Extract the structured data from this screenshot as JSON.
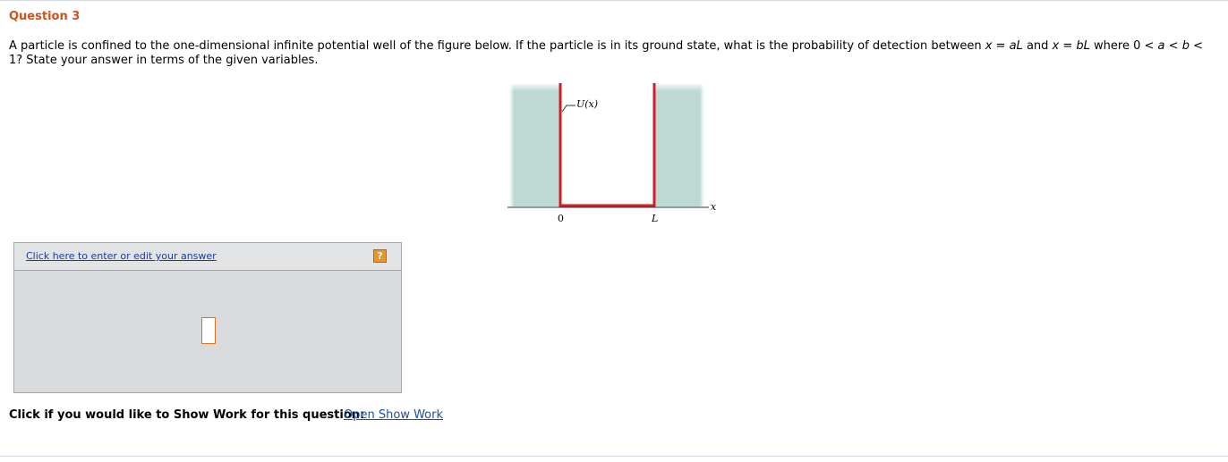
{
  "question": {
    "title": "Question 3",
    "text_before_x1": "A particle is confined to the one-dimensional infinite potential well of the figure below. If the particle is in its ground state, what is the probability of detection between ",
    "x1_var": "x",
    "x1_eq": " = ",
    "x1_val": "aL",
    "and": " and ",
    "x2_var": "x",
    "x2_eq": " = ",
    "x2_val": "bL",
    "where": " where 0 < ",
    "a": "a",
    "lt": " < ",
    "b": "b",
    "tail": " < 1? State your answer in terms of the given variables."
  },
  "figure": {
    "curve_label": "U(x)",
    "axis_label": "x",
    "tick_zero": "0",
    "tick_L": "L",
    "wall_color": "#d21f26",
    "region_color": "#bcd9d4"
  },
  "answer": {
    "link_text": "Click here to enter or edit your answer",
    "help_text": "?"
  },
  "show_work": {
    "label": "Click if you would like to Show Work for this question:",
    "link_text": "Open Show Work"
  }
}
